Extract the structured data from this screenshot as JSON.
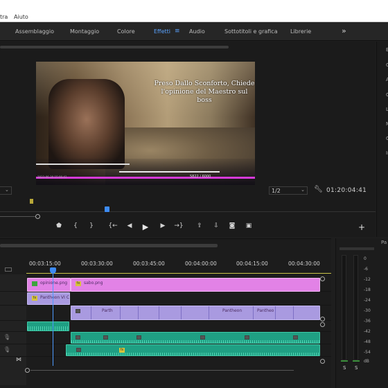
{
  "menubar": {
    "items": [
      "tra",
      "Aiuto"
    ]
  },
  "workspaces": {
    "tabs": [
      "Assemblaggio",
      "Montaggio",
      "Colore",
      "Effetti",
      "Audio",
      "Sottotitoli e grafica",
      "Librerie"
    ],
    "active": "Effetti",
    "menu_icon": "hamburger-icon",
    "more_icon": "double-chevron-right-icon"
  },
  "program_monitor": {
    "caption": "Preso Dallo Sconforto, Chiede l'opinione del Maestro sul boss",
    "hud_counter": "5822 / 6000",
    "hud_date": "2023-06-30 15:06:41",
    "fit_value": "",
    "resolution": "1/2",
    "timecode": "01:20:04:41"
  },
  "right_panel_letters": [
    "E",
    "G",
    "A",
    "C",
    "L",
    "M",
    "C",
    "In"
  ],
  "transport": {
    "buttons": [
      "marker-icon",
      "mark-in-icon",
      "mark-out-icon",
      "go-to-in-icon",
      "step-back-icon",
      "play-icon",
      "step-forward-icon",
      "go-to-out-icon",
      "lift-icon",
      "extract-icon",
      "export-frame-icon",
      "comparison-icon",
      "add-button-icon"
    ]
  },
  "timeline": {
    "ruler": [
      "00:03:15:00",
      "00:03:30:00",
      "00:03:45:00",
      "00:04:00:00",
      "00:04:15:00",
      "00:04:30:00"
    ],
    "clips": {
      "v3": [
        {
          "name": "opinione.png"
        },
        {
          "name": "sabo.png"
        }
      ],
      "v2": [
        {
          "name": "Pantheon VI C"
        }
      ],
      "v1": [
        {
          "name": "Parth"
        },
        {
          "name": "Pantheon"
        },
        {
          "name": "Pantheo"
        }
      ]
    }
  },
  "audio_meter": {
    "scale": [
      "0",
      "-6",
      "-12",
      "-18",
      "-24",
      "-30",
      "-36",
      "-42",
      "-48",
      "-54",
      "dB"
    ],
    "solo": [
      "S",
      "S"
    ],
    "panel_letter": "Pa"
  },
  "colors": {
    "accent": "#3d8bf5",
    "video_clip": "#e282e6",
    "nested_clip": "#a99ae0",
    "audio_clip": "#1f9f83"
  }
}
